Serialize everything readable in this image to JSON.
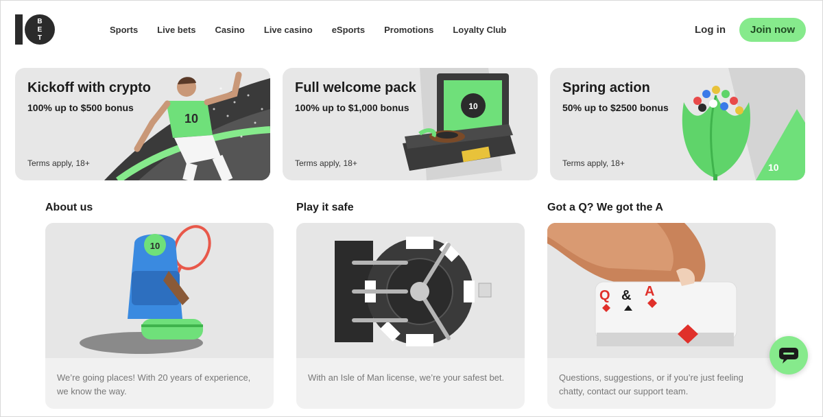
{
  "header": {
    "logo_text": "10BET",
    "nav": [
      "Sports",
      "Live bets",
      "Casino",
      "Live casino",
      "eSports",
      "Promotions",
      "Loyalty Club"
    ],
    "login_label": "Log in",
    "join_label": "Join now"
  },
  "promos": [
    {
      "title": "Kickoff with crypto",
      "subtitle": "100% up to $500 bonus",
      "terms": "Terms apply, 18+"
    },
    {
      "title": "Full welcome pack",
      "subtitle": "100% up to $1,000 bonus",
      "terms": "Terms apply, 18+"
    },
    {
      "title": "Spring action",
      "subtitle": "50% up to $2500 bonus",
      "terms": "Terms apply, 18+"
    }
  ],
  "info": [
    {
      "title": "About us",
      "text": "We’re going places! With 20 years of experience, we know the way."
    },
    {
      "title": "Play it safe",
      "text": "With an Isle of Man license, we’re your safest bet."
    },
    {
      "title": "Got a Q? We got the A",
      "text": "Questions, suggestions, or if you’re just feeling chatty, contact our support team."
    }
  ],
  "colors": {
    "accent": "#86ea8c",
    "card_bg": "#e7e7e7",
    "text_dark": "#1b1b1b"
  },
  "icons": {
    "chat": "chat-bubble-icon",
    "logo": "10bet-logo"
  }
}
